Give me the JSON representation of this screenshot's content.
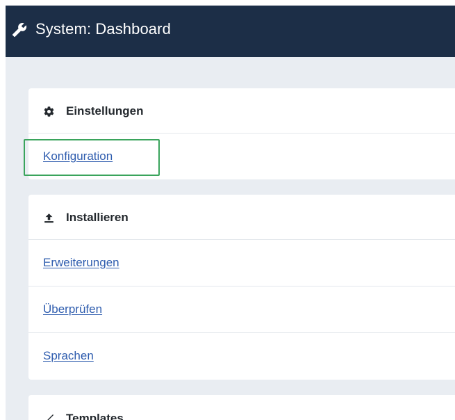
{
  "header": {
    "title": "System: Dashboard",
    "icon": "wrench-icon"
  },
  "sections": [
    {
      "title": "Einstellungen",
      "icon": "gear-icon",
      "links": [
        "Konfiguration"
      ]
    },
    {
      "title": "Installieren",
      "icon": "upload-icon",
      "links": [
        "Erweiterungen",
        "Überprüfen",
        "Sprachen"
      ]
    },
    {
      "title": "Templates",
      "icon": "brush-icon",
      "links": []
    }
  ],
  "colors": {
    "header_bg": "#1c2e47",
    "page_bg": "#e9edf2",
    "link": "#2e5cae",
    "highlight": "#3aa45c"
  }
}
